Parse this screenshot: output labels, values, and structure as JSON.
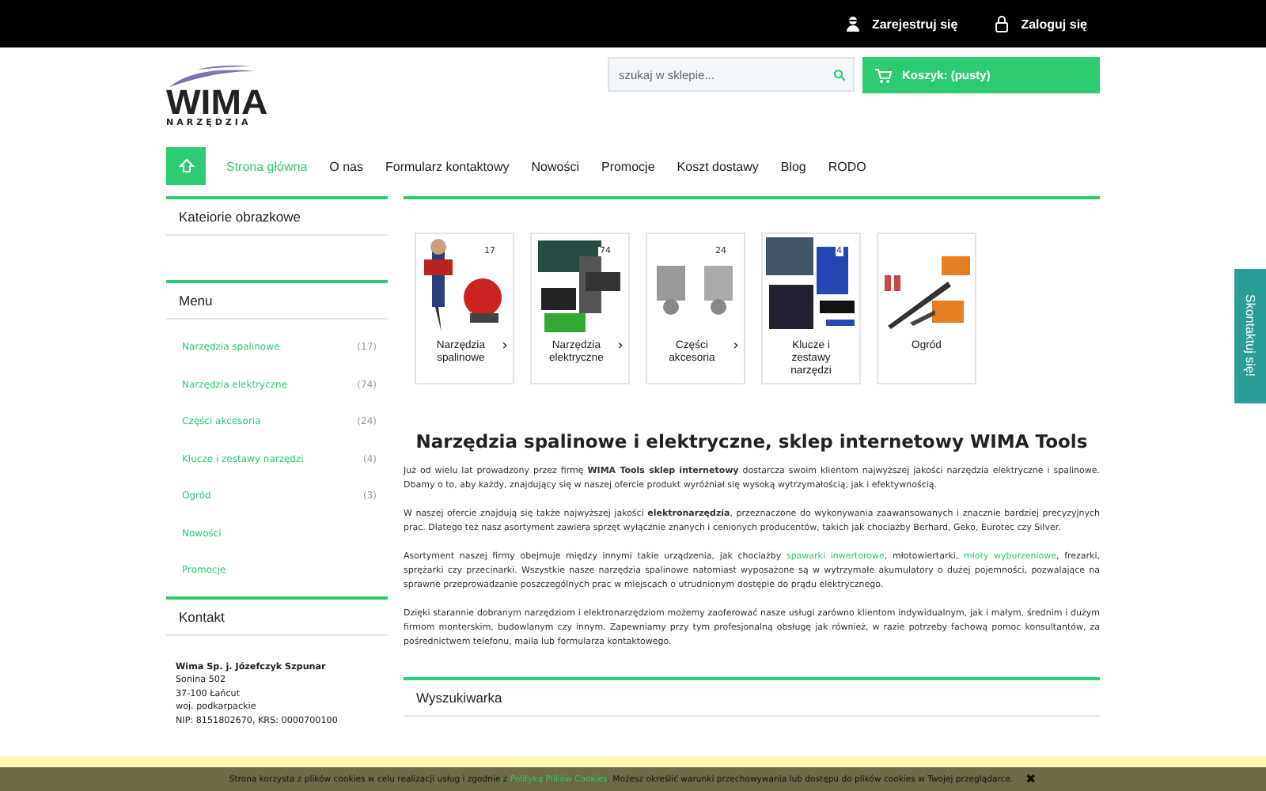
{
  "topbar": {
    "links": [
      {
        "label": "Zarejestruj się",
        "kind": "register"
      },
      {
        "label": "Zaloguj się",
        "kind": "login"
      }
    ]
  },
  "logo": {
    "name": "WIMA",
    "tagline": "NARZĘDZIA"
  },
  "search": {
    "placeholder": "szukaj w sklepie..."
  },
  "cart": {
    "label": "Koszyk: (pusty)"
  },
  "nav": [
    {
      "label": "Strona główna",
      "selected": true
    },
    {
      "label": "O nas",
      "selected": false
    },
    {
      "label": "Formularz kontaktowy",
      "selected": false
    },
    {
      "label": "Nowości",
      "selected": false
    },
    {
      "label": "Promocje",
      "selected": false
    },
    {
      "label": "Koszt dostawy",
      "selected": false
    },
    {
      "label": "Blog",
      "selected": false
    },
    {
      "label": "RODO",
      "selected": false
    }
  ],
  "sidebar": {
    "image_categories": {
      "title": "Kateiorie obrazkowe"
    },
    "menu": {
      "title": "Menu",
      "items": [
        {
          "label": "Narzędzia spalinowe",
          "count": "(17)"
        },
        {
          "label": "Narzędzia elektryczne",
          "count": "(74)"
        },
        {
          "label": "Części akcesoria",
          "count": "(24)"
        },
        {
          "label": "Klucze i zestawy narzędzi",
          "count": "(4)"
        },
        {
          "label": "Ogród",
          "count": "(3)"
        },
        {
          "label": "Nowości"
        },
        {
          "label": "Promocje"
        }
      ]
    },
    "contact": {
      "title": "Kontakt",
      "company": "Wima Sp. j. Józefczyk Szpunar",
      "lines": [
        "Sonina 502",
        "37-100 Łańcut",
        "woj. podkarpackie",
        "NIP: 8151802670, KRS: 0000700100"
      ]
    }
  },
  "categories": [
    {
      "label": "Narzędzia spalinowe",
      "arrow": "›",
      "badge": "17"
    },
    {
      "label": "Narzędzia elektryczne",
      "arrow": "›",
      "badge": "74"
    },
    {
      "label": "Części akcesoria",
      "arrow": "›",
      "badge": "24"
    },
    {
      "label": "Klucze i zestawy narzędzi",
      "badge": "4"
    },
    {
      "label": "Ogród"
    }
  ],
  "article": {
    "title": "Narzędzia spalinowe i elektryczne, sklep internetowy WIMA Tools",
    "paragraphs": [
      [
        {
          "kind": "text",
          "text": "Już od wielu lat prowadzony przez firmę **WIMA Tools sklep internetowy** dostarcza swoim klientom najwyższej jakości narzędzia elektryczne i spalinowe. Dbamy o to, aby każdy, znajdujący się w naszej ofercie produkt wyróżniał się wysoką wytrzymałością, jak i efektywnością."
        }
      ],
      [
        {
          "kind": "text",
          "text": "W naszej ofercie znajdują się także najwyższej jakości **elektronarzędzia**, przeznaczone do wykonywania zaawansowanych i znacznie bardziej precyzyjnych prac. Dlatego też nasz asortyment zawiera sprzęt wyłącznie znanych i cenionych producentów, takich jak chociażby Berhard, Geko, Eurotec czy Silver."
        }
      ],
      [
        {
          "kind": "text",
          "text": "Asortyment naszej firmy obejmuje między innymi takie urządzenia, jak chociażby "
        },
        {
          "kind": "link",
          "text": "spawarki inwertorowe"
        },
        {
          "kind": "text",
          "text": ", młotowiertarki, "
        },
        {
          "kind": "link",
          "text": "młoty wyburzeniowe"
        },
        {
          "kind": "text",
          "text": ", frezarki, sprężarki czy przecinarki. Wszystkie nasze narzędzia spalinowe natomiast wyposażone są w wytrzymałe akumulatory o dużej pojemności, pozwalające na sprawne przeprowadzanie poszczególnych prac w miejscach o utrudnionym dostępie do prądu elektrycznego."
        }
      ],
      [
        {
          "kind": "text",
          "text": "Dzięki starannie dobranym narzędziom i elektronarzędziom możemy zaoferować nasze usługi zarówno klientom indywidualnym, jak i małym, średnim i dużym firmom monterskim, budowlanym czy innym. Zapewniamy przy tym profesjonalną obsługę jak również, w razie potrzeby fachową pomoc konsultantów, za pośrednictwem telefonu, maila lub formularza kontaktowego."
        }
      ]
    ]
  },
  "search_box": {
    "title": "Wyszukiwarka"
  },
  "contact_tab": {
    "label": "Skontaktuj się!"
  },
  "cookie_bar": {
    "parts": [
      {
        "kind": "text",
        "text": "Strona korzysta z plików cookies w celu realizacji usług i zgodnie z "
      },
      {
        "kind": "link",
        "text": "Polityką Plików Cookies"
      },
      {
        "kind": "text",
        "text": ". Możesz określić warunki przechowywania lub dostępu do plików cookies w Twojej przeglądarce."
      }
    ],
    "close": "✖"
  }
}
